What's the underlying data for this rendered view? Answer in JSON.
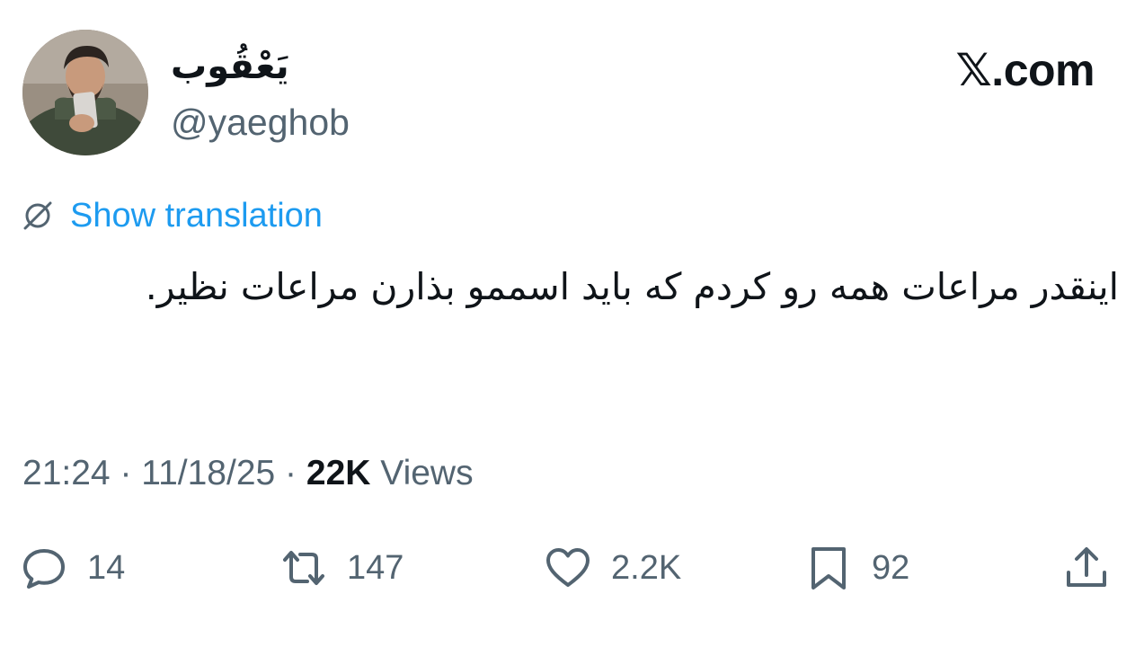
{
  "author": {
    "display_name": "يَعْقُوب",
    "handle": "@yaeghob"
  },
  "brand": "𝕏.com",
  "translate": {
    "label": "Show translation",
    "icon": "globe-icon"
  },
  "tweet": {
    "text": "اینقدر مراعات همه رو کردم که باید اسممو بذارن مراعات نظیر."
  },
  "meta": {
    "time": "21:24",
    "separator": " · ",
    "date": "11/18/25",
    "views_count": "22K",
    "views_label": " Views"
  },
  "actions": {
    "reply": {
      "icon": "reply-icon",
      "count": "14"
    },
    "repost": {
      "icon": "repost-icon",
      "count": "147"
    },
    "like": {
      "icon": "heart-icon",
      "count": "2.2K"
    },
    "bookmark": {
      "icon": "bookmark-icon",
      "count": "92"
    },
    "share": {
      "icon": "share-icon"
    }
  },
  "colors": {
    "text": "#0f1419",
    "secondary": "#536471",
    "link": "#1d9bf0",
    "background": "#ffffff"
  }
}
